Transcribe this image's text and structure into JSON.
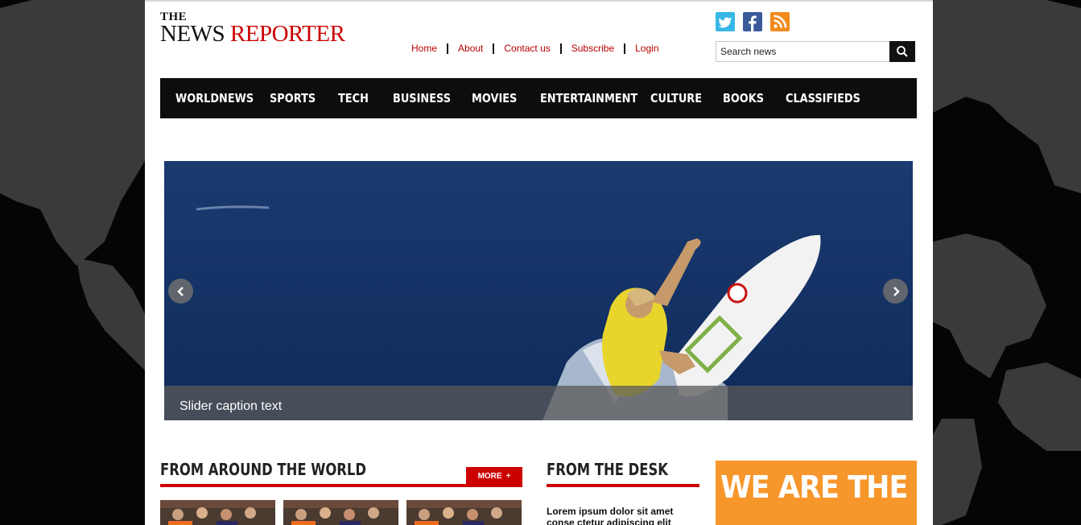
{
  "brand": {
    "logo_the": "THE",
    "logo_news": "NEWS",
    "logo_reporter": "REPORTER"
  },
  "top_links": [
    "Home",
    "About",
    "Contact us",
    "Subscribe",
    "Login"
  ],
  "social": [
    "twitter-icon",
    "facebook-icon",
    "rss-icon"
  ],
  "search": {
    "placeholder": "Search news"
  },
  "nav": [
    "WORLDNEWS",
    "SPORTS",
    "TECH",
    "BUSINESS",
    "MOVIES",
    "ENTERTAINMENT",
    "CULTURE",
    "BOOKS",
    "CLASSIFIEDS"
  ],
  "slider": {
    "caption": "Slider caption text"
  },
  "sections": {
    "world": {
      "title": "FROM AROUND THE WORLD",
      "more": "MORE"
    },
    "desk": {
      "title": "FROM THE DESK",
      "text": "Lorem ipsum dolor sit amet conse ctetur adipiscing elit"
    }
  },
  "ad": {
    "text": "WE ARE THE WORLD'S"
  },
  "colors": {
    "accent": "#cc0000",
    "nav_bg": "#0d0d0d",
    "ad_bg": "#f7962b"
  }
}
